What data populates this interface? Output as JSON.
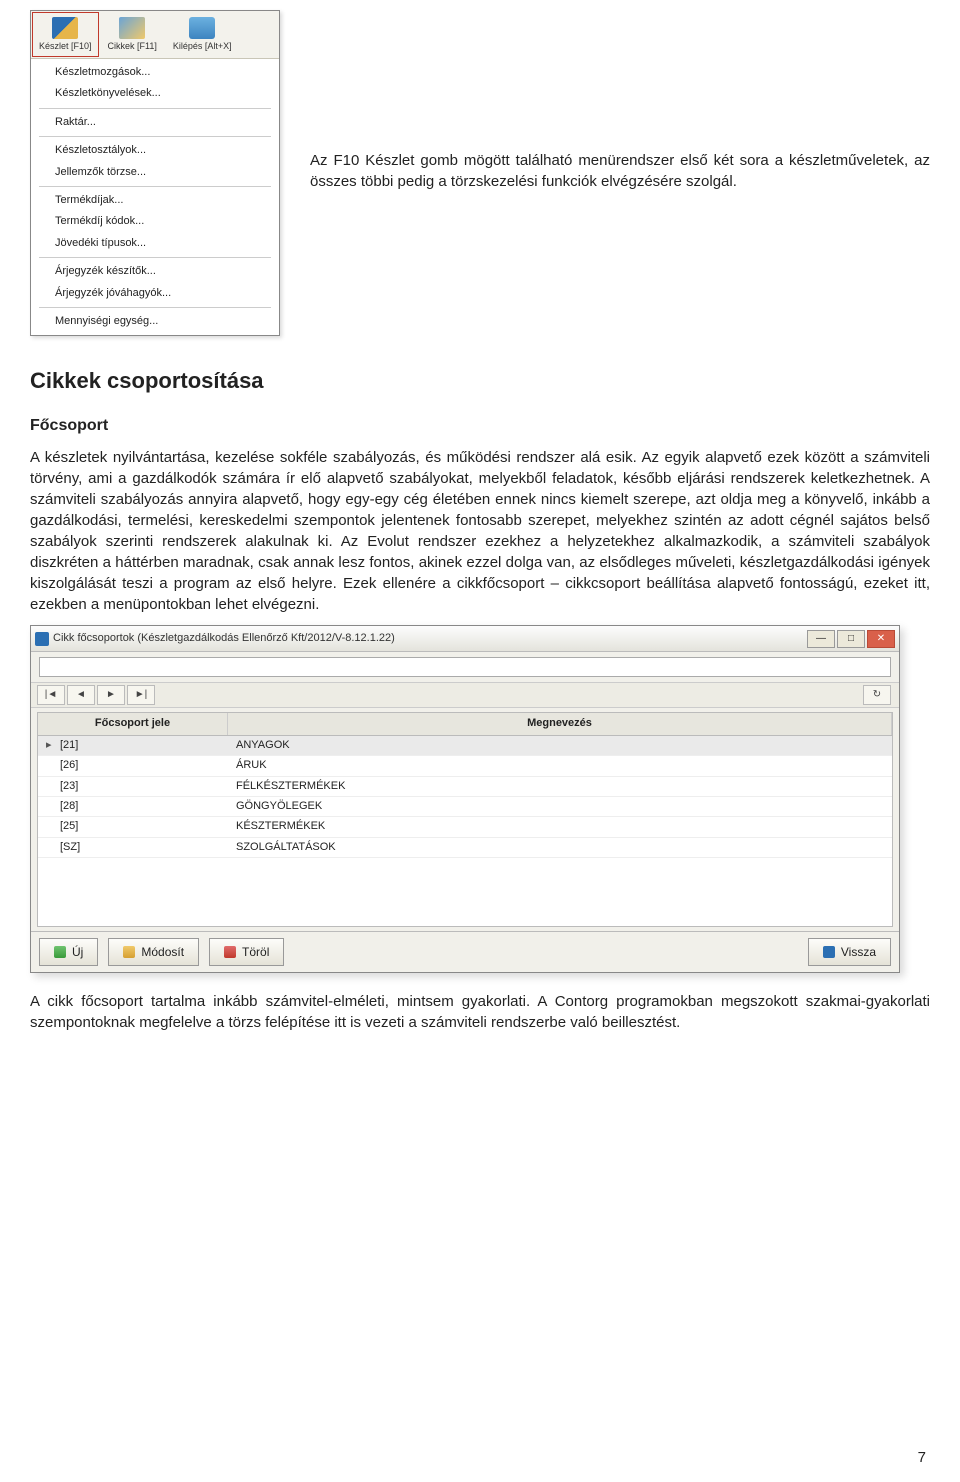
{
  "toolbar": {
    "buttons": [
      {
        "name": "keszlet",
        "label": "Készlet [F10]",
        "active": true
      },
      {
        "name": "cikkek",
        "label": "Cikkek  [F11]",
        "active": false
      },
      {
        "name": "kilepes",
        "label": "Kilépés [Alt+X]",
        "active": false
      }
    ]
  },
  "menu": {
    "items": [
      "Készletmozgások...",
      "Készletkönyvelések...",
      "---",
      "Raktár...",
      "---",
      "Készletosztályok...",
      "Jellemzők törzse...",
      "---",
      "Termékdíjak...",
      "Termékdíj kódok...",
      "Jövedéki típusok...",
      "---",
      "Árjegyzék készítők...",
      "Árjegyzék jóváhagyók...",
      "---",
      "Mennyiségi egység..."
    ]
  },
  "top_caption": "Az F10 Készlet gomb mögött található menürendszer első két sora a készletműveletek, az összes többi pedig a törzskezelési funkciók elvégzésére szolgál.",
  "h2": "Cikkek csoportosítása",
  "h3": "Főcsoport",
  "body_p1": "A készletek nyilvántartása, kezelése sokféle szabályozás, és működési rendszer alá esik. Az egyik alapvető ezek között a számviteli törvény, ami a gazdálkodók számára ír elő alapvető szabályokat, melyekből feladatok, később eljárási rendszerek keletkezhetnek. A számviteli szabályozás annyira alapvető, hogy egy-egy cég életében ennek nincs kiemelt szerepe, azt oldja meg a könyvelő, inkább a gazdálkodási, termelési, kereskedelmi szempontok jelentenek fontosabb szerepet, melyekhez szintén az adott cégnél sajátos belső szabályok szerinti rendszerek alakulnak ki. Az Evolut rendszer ezekhez a helyzetekhez alkalmazkodik, a számviteli szabályok diszkréten a háttérben maradnak, csak annak lesz fontos, akinek ezzel dolga van, az elsődleges műveleti, készletgazdálkodási igények kiszolgálását teszi a program az első helyre. Ezek ellenére a cikkfőcsoport – cikkcsoport beállítása alapvető fontosságú, ezeket itt, ezekben a menüpontokban lehet elvégezni.",
  "dialog": {
    "title": "Cikk főcsoportok (Készletgazdálkodás Ellenőrző Kft/2012/V-8.12.1.22)",
    "search_placeholder": "",
    "nav": {
      "first": "|◄",
      "prev": "◄",
      "next": "►",
      "last": "►|",
      "refresh": "↻"
    },
    "headers": {
      "col1": "Főcsoport jele",
      "col2": "Megnevezés"
    },
    "rows": [
      {
        "code": "[21]",
        "name": "ANYAGOK",
        "selected": true
      },
      {
        "code": "[26]",
        "name": "ÁRUK"
      },
      {
        "code": "[23]",
        "name": "FÉLKÉSZTERMÉKEK"
      },
      {
        "code": "[28]",
        "name": "GÖNGYÖLEGEK"
      },
      {
        "code": "[25]",
        "name": "KÉSZTERMÉKEK"
      },
      {
        "code": "[SZ]",
        "name": "SZOLGÁLTATÁSOK"
      }
    ],
    "buttons": {
      "new": "Új",
      "modify": "Módosít",
      "delete": "Töröl",
      "back": "Vissza"
    }
  },
  "body_p2": "A cikk főcsoport tartalma inkább számvitel-elméleti, mintsem gyakorlati. A Contorg programokban megszokott szakmai-gyakorlati szempontoknak megfelelve a törzs felépítése itt is vezeti a számviteli rendszerbe való beillesztést.",
  "page_number": "7"
}
